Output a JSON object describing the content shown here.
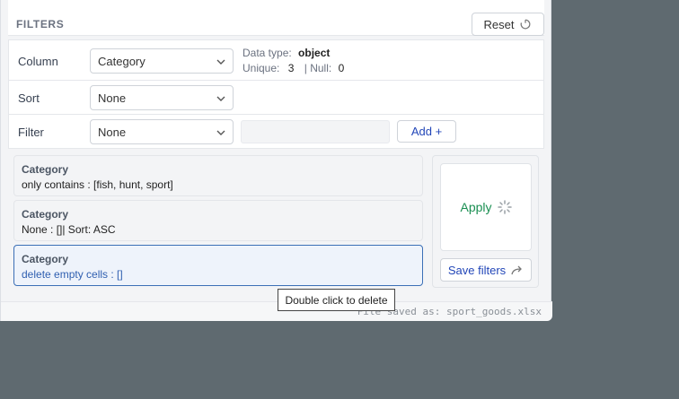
{
  "filters_panel": {
    "title": "FILTERS",
    "reset_label": "Reset"
  },
  "controls": {
    "column": {
      "label": "Column",
      "selected": "Category",
      "meta": {
        "data_type_label": "Data type:",
        "data_type_value": "object",
        "unique_label": "Unique:",
        "unique_value": "3",
        "null_label": "| Null:",
        "null_value": "0"
      }
    },
    "sort": {
      "label": "Sort",
      "selected": "None"
    },
    "filter": {
      "label": "Filter",
      "selected": "None",
      "value": "",
      "add_label": "Add +"
    }
  },
  "filter_stack": [
    {
      "title": "Category",
      "detail": "only contains : [fish, hunt, sport]",
      "selected": false
    },
    {
      "title": "Category",
      "detail": "None : []| Sort: ASC",
      "selected": false
    },
    {
      "title": "Category",
      "detail": "delete empty cells : []",
      "selected": true
    }
  ],
  "actions": {
    "apply_label": "Apply",
    "save_filters_label": "Save filters"
  },
  "footer": {
    "status": "File saved as: sport_goods.xlsx"
  },
  "tooltip": {
    "text": "Double click to delete"
  },
  "colors": {
    "accent_blue": "#2246b8",
    "apply_green": "#1a8f52",
    "selected_border": "#3b6fb6",
    "background": "#5f6a70"
  }
}
